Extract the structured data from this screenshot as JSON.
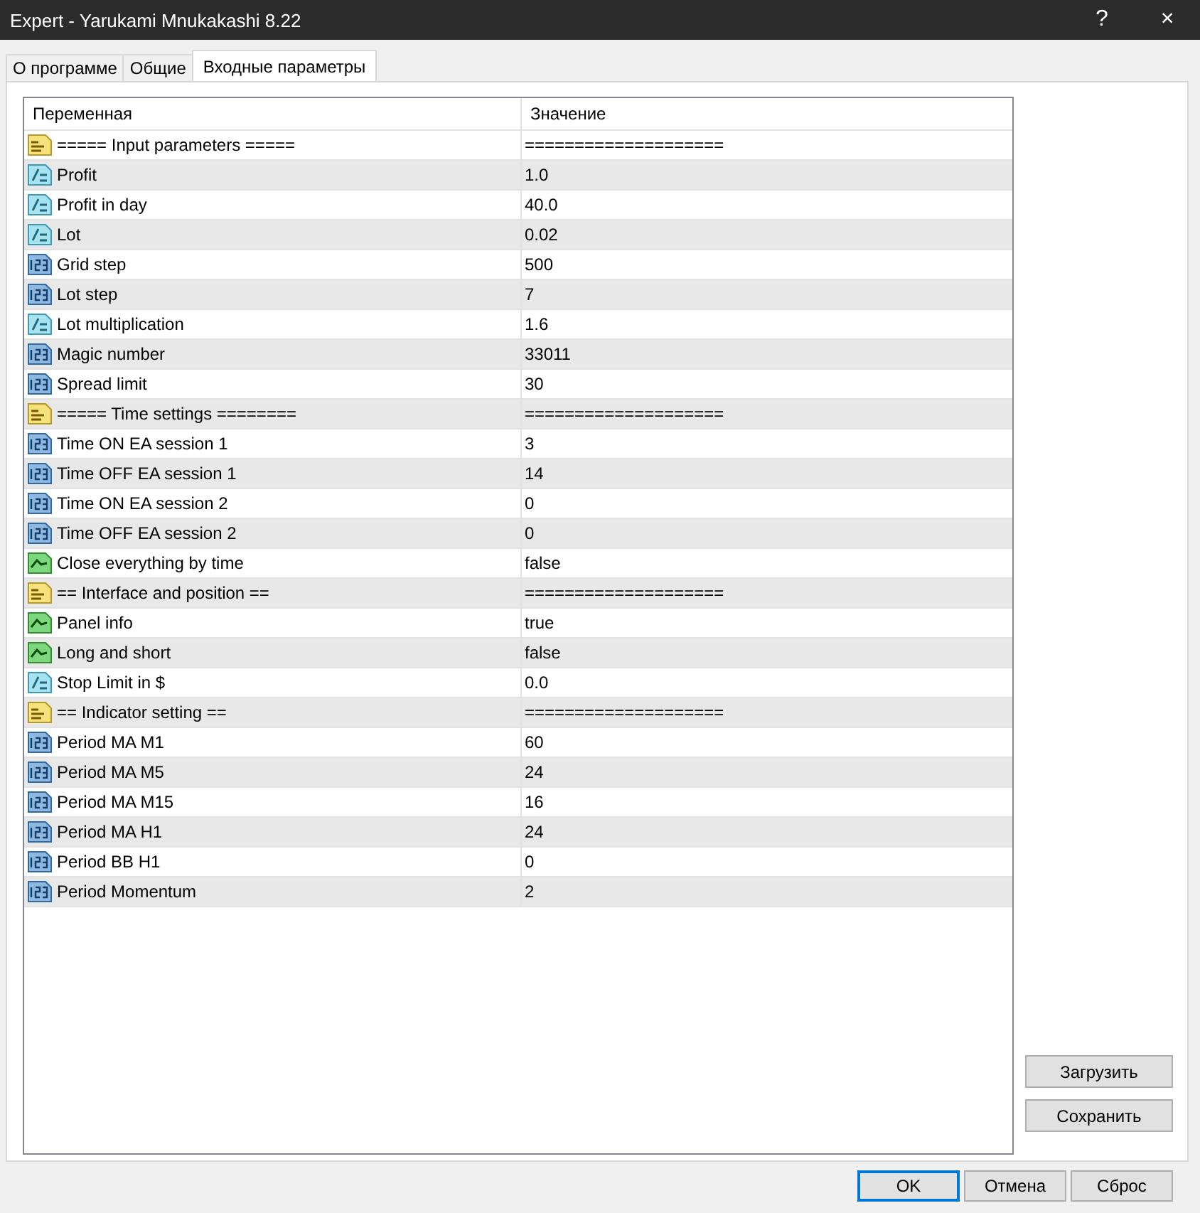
{
  "window": {
    "title": "Expert - Yarukami Mnukakashi 8.22",
    "help": "?",
    "close": "×"
  },
  "tabs": [
    {
      "label": "О программе",
      "selected": false
    },
    {
      "label": "Общие",
      "selected": false
    },
    {
      "label": "Входные параметры",
      "selected": true
    }
  ],
  "table": {
    "columns": [
      "Переменная",
      "Значение"
    ],
    "rows": [
      {
        "kind": "string",
        "name": "===== Input parameters =====",
        "value": "===================="
      },
      {
        "kind": "double",
        "name": "Profit",
        "value": "1.0"
      },
      {
        "kind": "double",
        "name": "Profit in day",
        "value": "40.0"
      },
      {
        "kind": "double",
        "name": "Lot",
        "value": "0.02"
      },
      {
        "kind": "int",
        "name": "Grid step",
        "value": "500"
      },
      {
        "kind": "int",
        "name": "Lot step",
        "value": "7"
      },
      {
        "kind": "double",
        "name": "Lot multiplication",
        "value": "1.6"
      },
      {
        "kind": "int",
        "name": "Magic number",
        "value": "33011"
      },
      {
        "kind": "int",
        "name": "Spread limit",
        "value": "30"
      },
      {
        "kind": "string",
        "name": "===== Time settings ========",
        "value": "===================="
      },
      {
        "kind": "int",
        "name": "Time ON EA session 1",
        "value": "3"
      },
      {
        "kind": "int",
        "name": "Time OFF EA session 1",
        "value": "14"
      },
      {
        "kind": "int",
        "name": "Time ON EA session 2",
        "value": "0"
      },
      {
        "kind": "int",
        "name": "Time OFF EA session 2",
        "value": "0"
      },
      {
        "kind": "bool",
        "name": "Close everything by time",
        "value": "false"
      },
      {
        "kind": "string",
        "name": "== Interface and position ==",
        "value": "===================="
      },
      {
        "kind": "bool",
        "name": "Panel info",
        "value": "true"
      },
      {
        "kind": "bool",
        "name": "Long and short",
        "value": "false"
      },
      {
        "kind": "double",
        "name": "Stop Limit in $",
        "value": "0.0"
      },
      {
        "kind": "string",
        "name": "== Indicator setting ==",
        "value": "===================="
      },
      {
        "kind": "int",
        "name": "Period MA M1",
        "value": "60"
      },
      {
        "kind": "int",
        "name": "Period MA M5",
        "value": "24"
      },
      {
        "kind": "int",
        "name": "Period MA M15",
        "value": "16"
      },
      {
        "kind": "int",
        "name": "Period MA H1",
        "value": "24"
      },
      {
        "kind": "int",
        "name": "Period BB H1",
        "value": "0"
      },
      {
        "kind": "int",
        "name": "Period Momentum",
        "value": "2"
      }
    ]
  },
  "side_buttons": [
    "Загрузить",
    "Сохранить"
  ],
  "buttons": [
    "OK",
    "Отмена",
    "Сброс"
  ]
}
